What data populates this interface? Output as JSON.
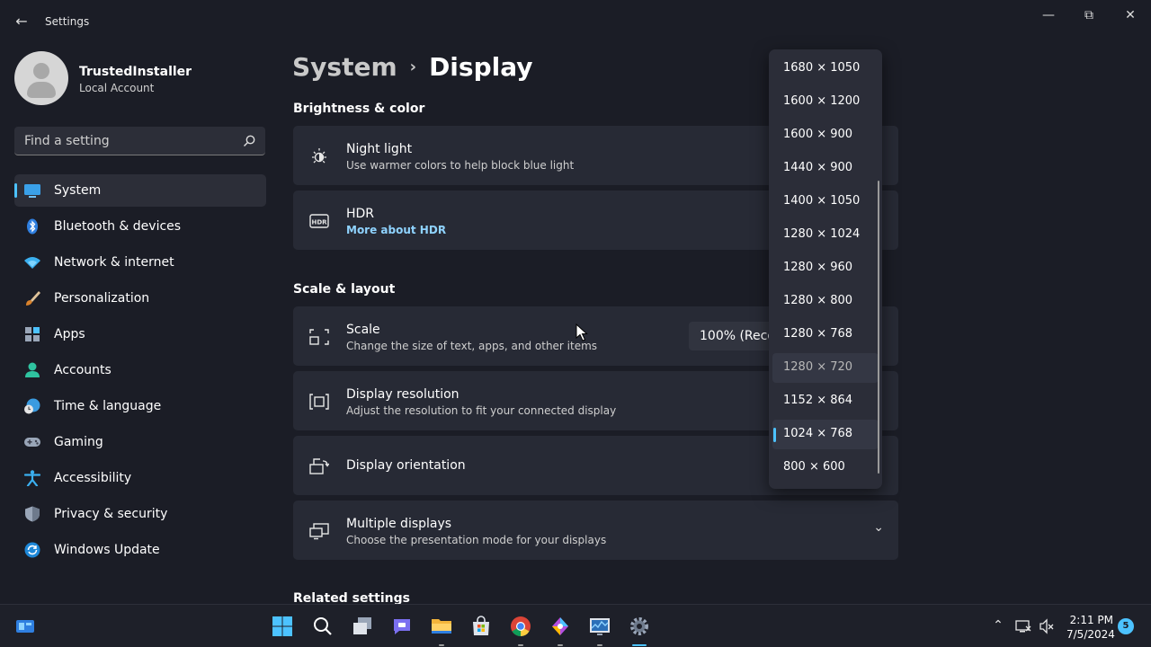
{
  "window": {
    "title": "Settings",
    "back_icon": "←",
    "minimize_icon": "—",
    "restore_icon": "⧉",
    "close_icon": "✕"
  },
  "user": {
    "name": "TrustedInstaller",
    "account_type": "Local Account"
  },
  "search": {
    "placeholder": "Find a setting"
  },
  "sidebar": {
    "items": [
      {
        "label": "System",
        "icon": "system-icon",
        "active": true
      },
      {
        "label": "Bluetooth & devices",
        "icon": "bluetooth-icon"
      },
      {
        "label": "Network & internet",
        "icon": "wifi-icon"
      },
      {
        "label": "Personalization",
        "icon": "brush-icon"
      },
      {
        "label": "Apps",
        "icon": "apps-icon"
      },
      {
        "label": "Accounts",
        "icon": "person-icon"
      },
      {
        "label": "Time & language",
        "icon": "globe-clock-icon"
      },
      {
        "label": "Gaming",
        "icon": "gamepad-icon"
      },
      {
        "label": "Accessibility",
        "icon": "accessibility-icon"
      },
      {
        "label": "Privacy & security",
        "icon": "shield-icon"
      },
      {
        "label": "Windows Update",
        "icon": "update-icon"
      }
    ]
  },
  "breadcrumb": {
    "parent": "System",
    "separator": "›",
    "current": "Display"
  },
  "sections": {
    "brightness": "Brightness & color",
    "scale_layout": "Scale & layout",
    "related": "Related settings"
  },
  "cards": {
    "night_light": {
      "title": "Night light",
      "subtitle": "Use warmer colors to help block blue light"
    },
    "hdr": {
      "title": "HDR",
      "link": "More about HDR",
      "icon_text": "HDR"
    },
    "scale": {
      "title": "Scale",
      "subtitle": "Change the size of text, apps, and other items",
      "value": "100% (Recommended)"
    },
    "resolution": {
      "title": "Display resolution",
      "subtitle": "Adjust the resolution to fit your connected display"
    },
    "orientation": {
      "title": "Display orientation"
    },
    "multiple": {
      "title": "Multiple displays",
      "subtitle": "Choose the presentation mode for your displays",
      "chevron": "⌄"
    }
  },
  "resolution_dropdown": {
    "options": [
      "1680 × 1050",
      "1600 × 1200",
      "1600 × 900",
      "1440 × 900",
      "1400 × 1050",
      "1280 × 1024",
      "1280 × 960",
      "1280 × 800",
      "1280 × 768",
      "1280 × 720",
      "1152 × 864",
      "1024 × 768",
      "800 × 600"
    ],
    "selected": "1024 × 768",
    "hovered": "1280 × 720"
  },
  "taskbar": {
    "apps": [
      "windows-start-icon",
      "search-icon",
      "task-view-icon",
      "teams-chat-icon",
      "file-explorer-icon",
      "microsoft-store-icon",
      "chrome-icon",
      "copilot-icon",
      "resource-monitor-icon",
      "settings-icon"
    ],
    "time": "2:11 PM",
    "date": "7/5/2024",
    "notification_count": "5"
  },
  "colors": {
    "accent": "#4cc2ff",
    "background": "#1b1d26",
    "card": "#272a35"
  }
}
